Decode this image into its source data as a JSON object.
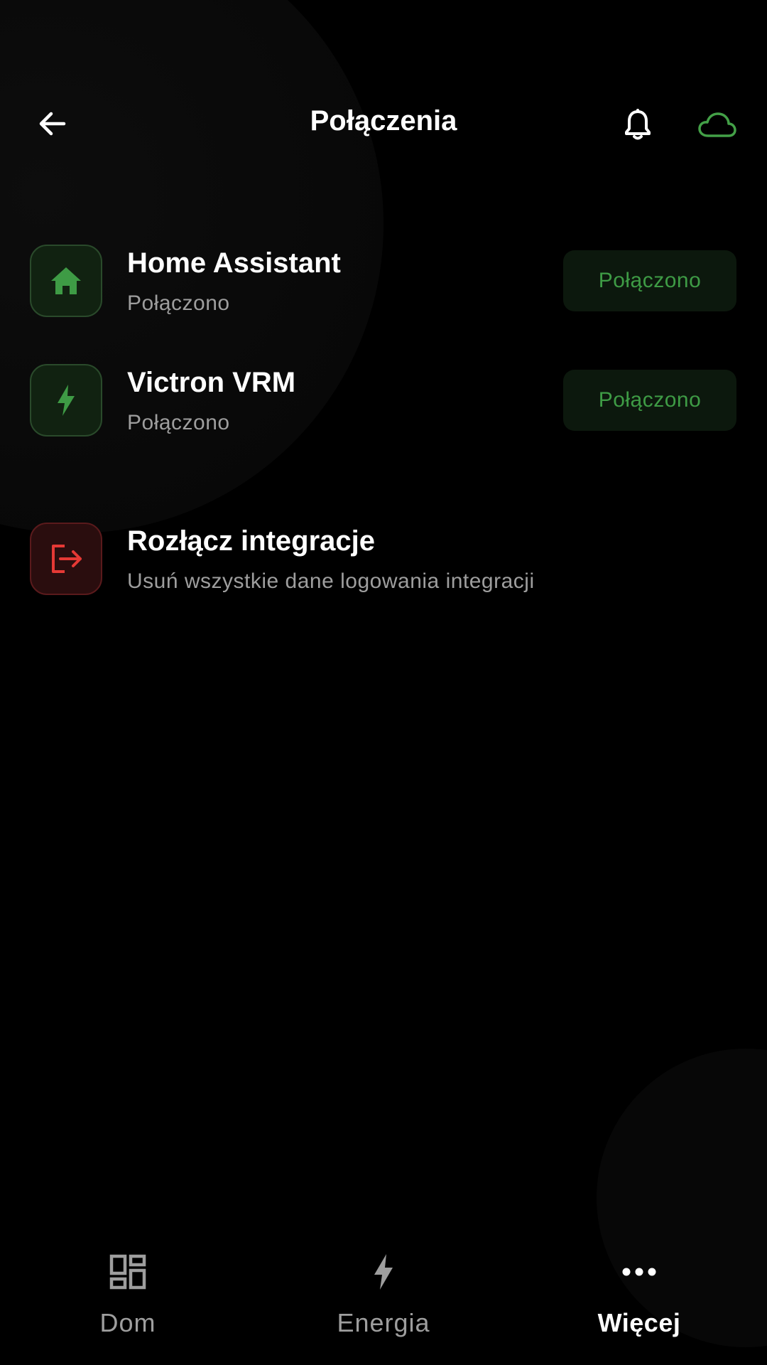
{
  "header": {
    "title": "Połączenia",
    "icons": {
      "back": "arrow-left-icon",
      "notifications": "bell-icon",
      "cloud": "cloud-icon"
    }
  },
  "colors": {
    "background": "#000000",
    "accent_green": "#3e9b45",
    "danger_red": "#e53935",
    "muted_text": "#9e9e9e",
    "cloud_icon": "#43a047"
  },
  "connections": [
    {
      "name": "Home Assistant",
      "status_text": "Połączono",
      "badge": "Połączono",
      "icon": "home-icon"
    },
    {
      "name": "Victron VRM",
      "status_text": "Połączono",
      "badge": "Połączono",
      "icon": "bolt-icon"
    }
  ],
  "disconnect": {
    "title": "Rozłącz integracje",
    "subtitle": "Usuń wszystkie dane logowania integracji",
    "icon": "logout-icon"
  },
  "bottom_nav": {
    "items": [
      {
        "label": "Dom",
        "icon": "dashboard-icon",
        "active": false
      },
      {
        "label": "Energia",
        "icon": "bolt-icon",
        "active": false
      },
      {
        "label": "Więcej",
        "icon": "more-horizontal-icon",
        "active": true
      }
    ]
  }
}
